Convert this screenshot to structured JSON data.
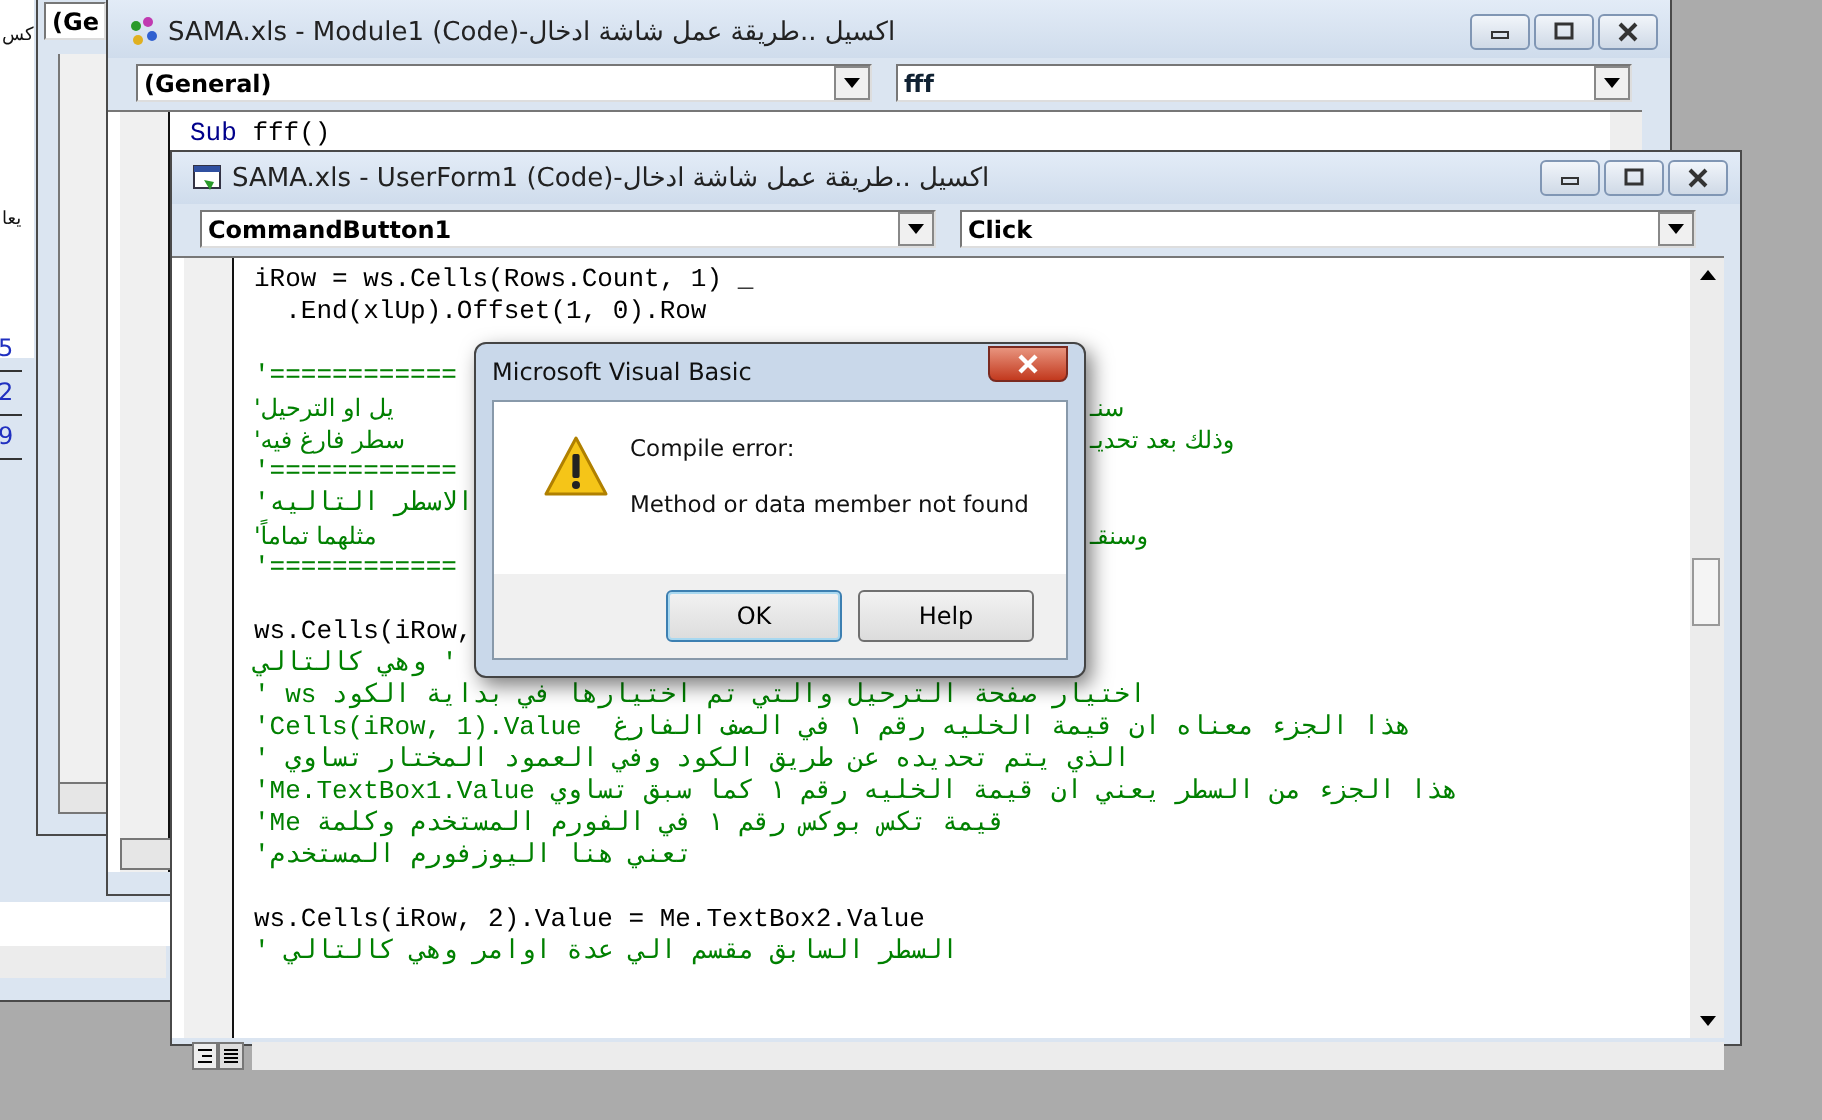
{
  "sheet_window": {
    "labels": [
      "كس",
      "يعا"
    ],
    "cells": [
      "5",
      "2",
      "9"
    ]
  },
  "project_window": {
    "combo": "(Ge"
  },
  "module_window": {
    "title": "اكسيل ..طريقة عمل شاشة ادخال-SAMA.xls - Module1 (Code)",
    "object_combo": "(General)",
    "procedure_combo": "fff",
    "code": [
      {
        "keyword": "Sub",
        "text": " fff()"
      }
    ]
  },
  "userform_window": {
    "title": "اكسيل ..طريقة عمل شاشة ادخال-SAMA.xls - UserForm1 (Code)",
    "object_combo": "CommandButton1",
    "procedure_combo": "Click",
    "code": [
      {
        "kind": "code",
        "text": "iRow = ws.Cells(Rows.Count, 1) _"
      },
      {
        "kind": "code",
        "text": "  .End(xlUp).Offset(1, 0).Row"
      },
      {
        "kind": "blank"
      },
      {
        "kind": "comment",
        "text": "'============"
      },
      {
        "kind": "comment",
        "text": "يل او الترحيل'",
        "after": "سنـ"
      },
      {
        "kind": "comment",
        "text": "سطر فارغ فيه'",
        "after": "وذلك بعد تحديـ"
      },
      {
        "kind": "comment",
        "text": "'============"
      },
      {
        "kind": "comment",
        "text": "الاسطر التاليه'"
      },
      {
        "kind": "comment",
        "text": "مثلهما تماماً'",
        "after": "وسنقـ"
      },
      {
        "kind": "comment",
        "text": "'============"
      },
      {
        "kind": "blank"
      },
      {
        "kind": "code",
        "text": "ws.Cells(iRow,"
      },
      {
        "kind": "comment",
        "text": "' وهي كالتالي"
      },
      {
        "kind": "comment",
        "text": "اختيار صفحة الترحيل والتي تم اختيارها في بداية الكود ws '"
      },
      {
        "kind": "comment",
        "text": "'Cells(iRow, 1).Value  هذا الجزء معناه ان قيمة الخليه رقم ١ في الصف الفارغ"
      },
      {
        "kind": "comment",
        "text": "الذي يتم تحديده عن طريق الكود وفي العمود المختار تساوي '"
      },
      {
        "kind": "comment",
        "text": "'Me.TextBox1.Value هذا الجزء من السطر يعني ان قيمة الخليه رقم ١ كما سبق تساوي"
      },
      {
        "kind": "comment",
        "text": "'Me قيمة تكس بوكس رقم ١ في الفورم المستخدم وكلمة"
      },
      {
        "kind": "comment",
        "text": "تعني هنا اليوزفورم المستخدم'"
      },
      {
        "kind": "blank"
      },
      {
        "kind": "code",
        "text": "ws.Cells(iRow, 2).Value = Me.TextBox2.Value"
      },
      {
        "kind": "comment",
        "text": "السطر السابق مقسم الي عدة اوامر وهي كالتالي '"
      }
    ]
  },
  "dialog": {
    "title": "Microsoft Visual Basic",
    "heading": "Compile error:",
    "message": "Method or data member not found",
    "ok_button": {
      "label": "OK",
      "default": true
    },
    "help_button": {
      "label": "Help",
      "default": false
    }
  }
}
